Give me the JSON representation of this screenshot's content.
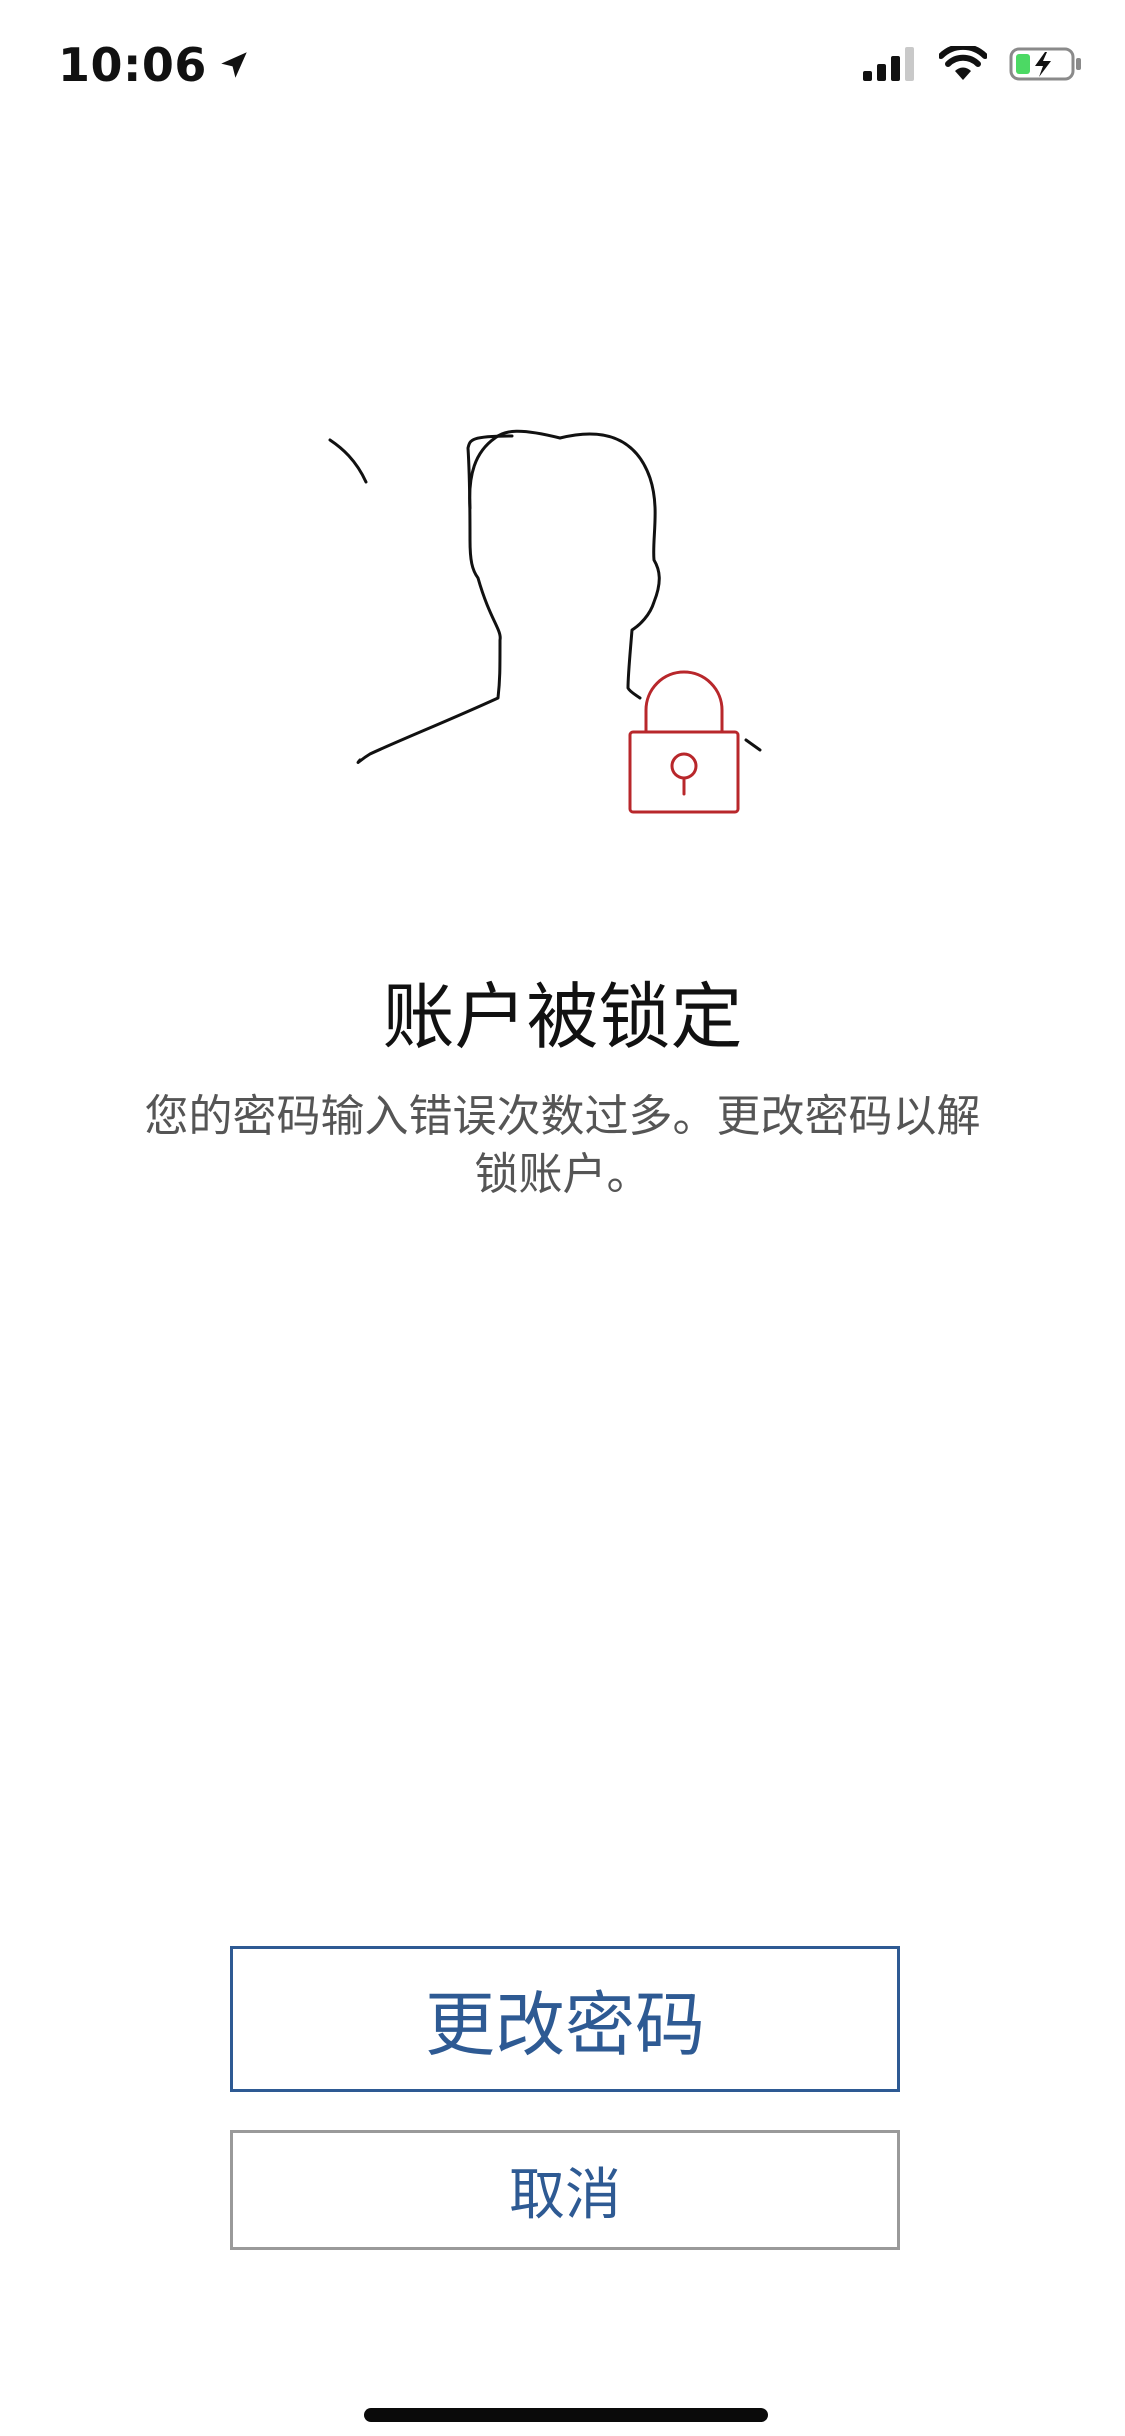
{
  "status_bar": {
    "time": "10:06"
  },
  "illustration": {
    "figure_color": "#111111",
    "lock_color": "#b8272b"
  },
  "content": {
    "title": "账户被锁定",
    "message": "您的密码输入错误次数过多。更改密码以解锁账户。"
  },
  "actions": {
    "change_password_label": "更改密码",
    "cancel_label": "取消"
  },
  "colors": {
    "accent": "#2e5a93",
    "secondary_border": "#9a9a9a"
  }
}
